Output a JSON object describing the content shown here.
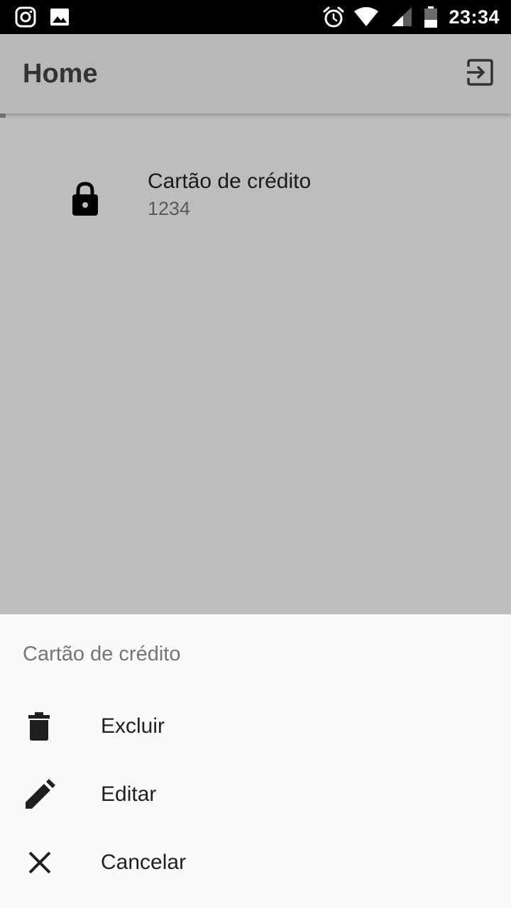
{
  "status_bar": {
    "time": "23:34",
    "left_icons": [
      "instagram-icon",
      "image-icon"
    ],
    "right_icons": [
      "alarm-icon",
      "wifi-icon",
      "signal-icon",
      "battery-icon"
    ]
  },
  "app_bar": {
    "title": "Home",
    "action_icon": "logout-icon"
  },
  "list": {
    "items": [
      {
        "icon": "lock-icon",
        "title": "Cartão de crédito",
        "subtitle": "1234"
      }
    ]
  },
  "bottom_sheet": {
    "title": "Cartão de crédito",
    "options": [
      {
        "icon": "delete-icon",
        "label": "Excluir"
      },
      {
        "icon": "edit-icon",
        "label": "Editar"
      },
      {
        "icon": "close-icon",
        "label": "Cancelar"
      }
    ]
  },
  "colors": {
    "status_bar": "#000000",
    "app_bar": "#b8b8b8",
    "scrim_background": "#bdbdbd",
    "sheet_background": "#fafafa"
  }
}
